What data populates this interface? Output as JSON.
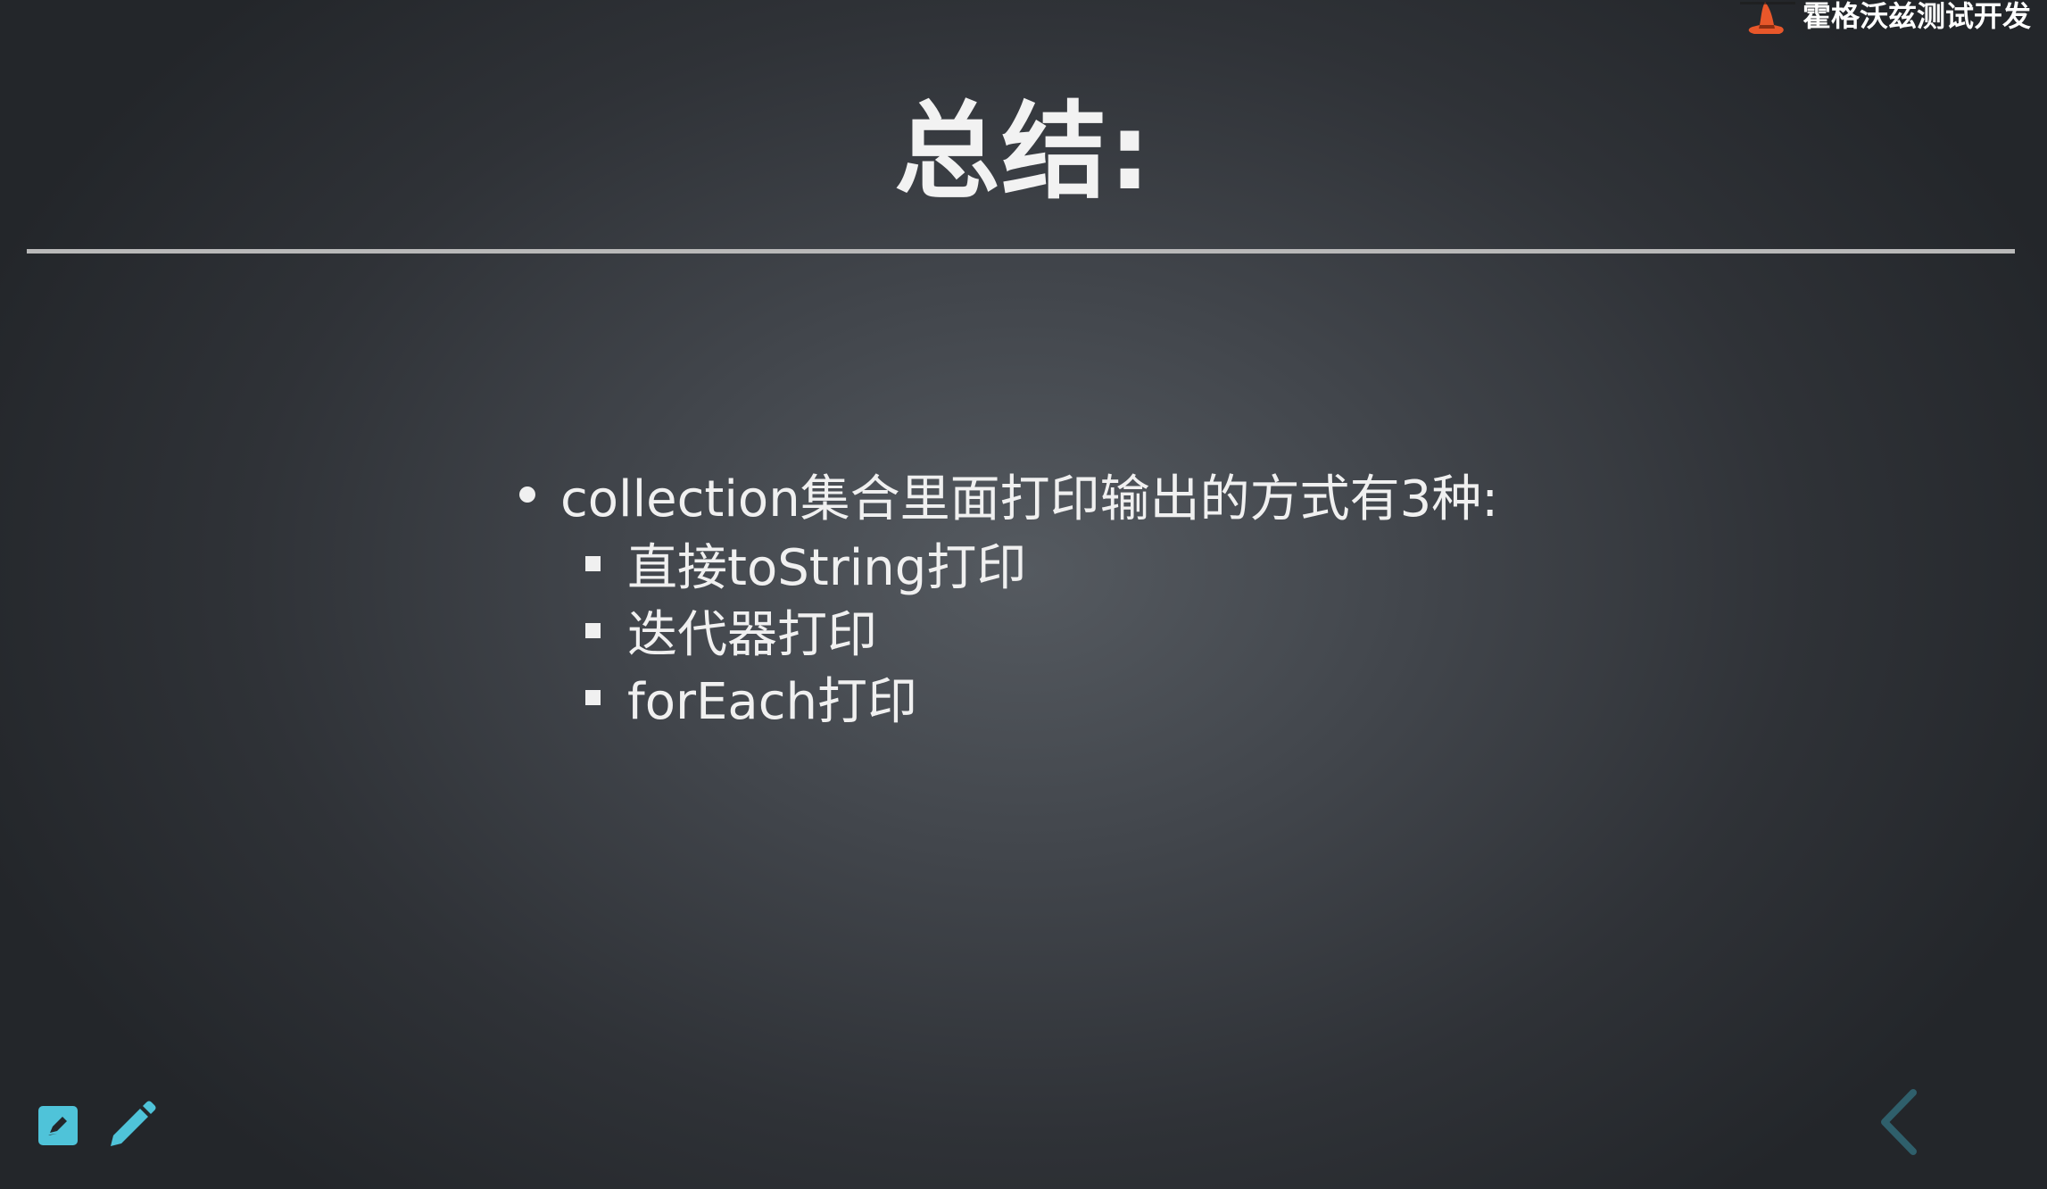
{
  "brand": {
    "text": "霍格沃兹测试开发",
    "logo_icon": "witch-hat-icon",
    "accent_color": "#e8572a"
  },
  "slide": {
    "title": "总结:",
    "bullets": [
      {
        "text": "collection集合里面打印输出的方式有3种:",
        "sub_items": [
          "直接toString打印",
          "迭代器打印",
          "forEach打印"
        ]
      }
    ]
  },
  "toolbar": {
    "notes_icon": "notes-edit-icon",
    "pen_icon": "pencil-icon",
    "icon_color": "#4fc3d9"
  },
  "navigation": {
    "prev_icon": "chevron-left-icon",
    "arrow_color": "#2f5f6b"
  }
}
